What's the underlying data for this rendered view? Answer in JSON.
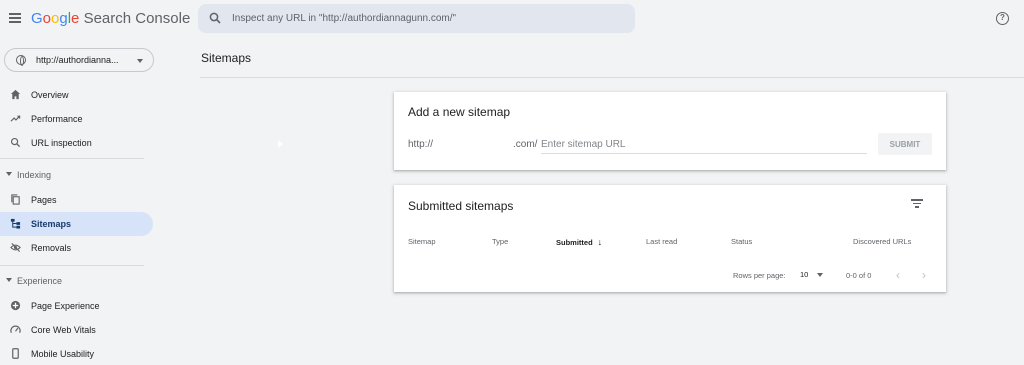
{
  "app": {
    "logo": {
      "G": "G",
      "o1": "o",
      "o2": "o",
      "g": "g",
      "l": "l",
      "e": "e",
      "product": "Search Console"
    }
  },
  "search": {
    "placeholder": "Inspect any URL in \"http://authordiannagunn.com/\""
  },
  "property": {
    "label": "http://authordianna..."
  },
  "sidebar": {
    "items": [
      {
        "label": "Overview",
        "icon": "home-icon"
      },
      {
        "label": "Performance",
        "icon": "trending-up-icon"
      },
      {
        "label": "URL inspection",
        "icon": "search-icon"
      }
    ],
    "indexing": {
      "header": "Indexing",
      "items": [
        {
          "label": "Pages",
          "icon": "pages-icon"
        },
        {
          "label": "Sitemaps",
          "icon": "sitemap-icon",
          "active": true
        },
        {
          "label": "Removals",
          "icon": "visibility-off-icon"
        }
      ]
    },
    "experience": {
      "header": "Experience",
      "items": [
        {
          "label": "Page Experience",
          "icon": "add-circle-icon"
        },
        {
          "label": "Core Web Vitals",
          "icon": "speedometer-icon"
        },
        {
          "label": "Mobile Usability",
          "icon": "phone-icon"
        }
      ]
    }
  },
  "main": {
    "title": "Sitemaps",
    "add_card": {
      "title": "Add a new sitemap",
      "prefix": "http://",
      "suffix": ".com/",
      "input_placeholder": "Enter sitemap URL",
      "submit_label": "SUBMIT"
    },
    "submitted_card": {
      "title": "Submitted sitemaps",
      "columns": [
        "Sitemap",
        "Type",
        "Submitted",
        "Last read",
        "Status",
        "Discovered URLs"
      ],
      "sort_arrow": "↓",
      "rows_per_page_label": "Rows per page:",
      "rows_per_page_value": "10",
      "range": "0-0 of 0",
      "prev": "‹",
      "next": "›"
    }
  },
  "colors": {
    "accent": "#1a73e8",
    "active_bg": "#d7e3f8",
    "bg": "#f1f3f4"
  }
}
